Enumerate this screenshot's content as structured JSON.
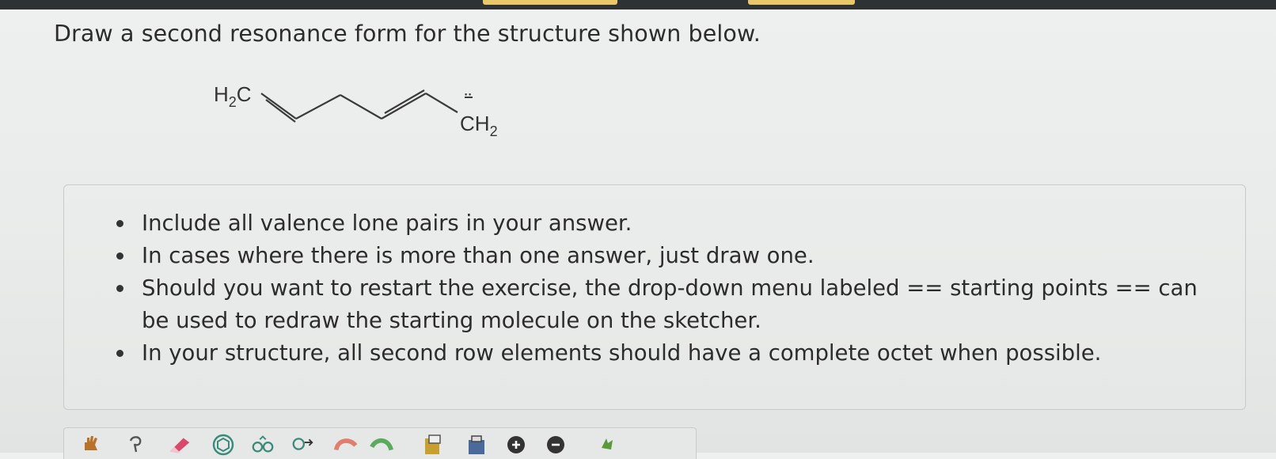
{
  "question": {
    "text": "Draw a second resonance form for the structure shown below."
  },
  "molecule": {
    "left_group": {
      "main": "H",
      "sub": "2",
      "tail": "C"
    },
    "right_group": {
      "main": "C",
      "tail": "H",
      "sub": "2"
    },
    "lone_pair": "¨"
  },
  "instructions": {
    "items": [
      "Include all valence lone pairs in your answer.",
      "In cases where there is more than one answer, just draw one.",
      "Should you want to restart the exercise, the drop-down menu labeled == starting points == can be used to redraw the starting molecule on the sketcher.",
      "In your structure, all second row elements should have a complete octet when possible."
    ]
  },
  "toolbar": {
    "tools": [
      {
        "name": "hand-tool-icon",
        "color": "#b8722c"
      },
      {
        "name": "lasso-tool-icon",
        "color": "#555555"
      },
      {
        "name": "eraser-tool-icon",
        "color": "#d94a6a"
      },
      {
        "name": "ring-template-icon",
        "color": "#3a8a7a"
      },
      {
        "name": "chain-template-icon",
        "color": "#3a8a7a"
      },
      {
        "name": "atom-map-icon",
        "color": "#3a8a7a"
      },
      {
        "name": "undo-icon",
        "color": "#e07f70"
      },
      {
        "name": "redo-icon",
        "color": "#5cab5c"
      },
      {
        "name": "paste-icon",
        "color": "#c9a030"
      },
      {
        "name": "clean-icon",
        "color": "#4a6a9a"
      },
      {
        "name": "zoom-in-icon",
        "color": "#333333"
      },
      {
        "name": "zoom-out-icon",
        "color": "#333333"
      },
      {
        "name": "settings-icon",
        "color": "#5a9a3a"
      }
    ]
  },
  "colors": {
    "text": "#2c2c2c",
    "panel_border": "#c9cbca",
    "top_bar": "#2f3232",
    "top_bar_tab": "#e8c86a"
  }
}
